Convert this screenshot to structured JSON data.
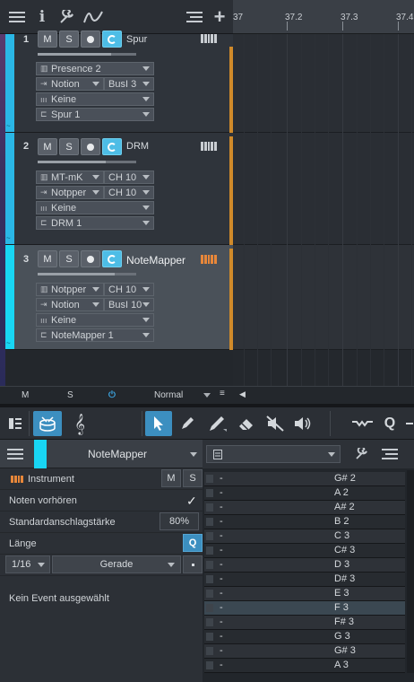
{
  "toolbar": {
    "icons": [
      "menu-icon",
      "info-icon",
      "wrench-icon",
      "automation-curve-icon",
      "list-icon",
      "plus-icon"
    ]
  },
  "ruler": {
    "marks": [
      "37",
      "37.2",
      "37.3",
      "37.4"
    ]
  },
  "tracks": [
    {
      "number": "1",
      "name": "Spur",
      "mute": "M",
      "solo": "S",
      "rows": [
        {
          "icon": "keyboard-icon",
          "a": "Presence 2",
          "b": ""
        },
        {
          "icon": "input-icon",
          "a": "Notion",
          "b": "BusI 3"
        },
        {
          "icon": "bars-icon",
          "a": "Keine",
          "b": ""
        },
        {
          "icon": "output-icon",
          "a": "Spur 1",
          "b": ""
        }
      ]
    },
    {
      "number": "2",
      "name": "DRM",
      "mute": "M",
      "solo": "S",
      "rows": [
        {
          "icon": "keyboard-icon",
          "a": "MT-mK",
          "b": "CH 10"
        },
        {
          "icon": "input-icon",
          "a": "Notpper",
          "b": "CH 10"
        },
        {
          "icon": "bars-icon",
          "a": "Keine",
          "b": ""
        },
        {
          "icon": "output-icon",
          "a": "DRM 1",
          "b": ""
        }
      ]
    },
    {
      "number": "3",
      "name": "NoteMapper",
      "mute": "M",
      "solo": "S",
      "rows": [
        {
          "icon": "keyboard-icon",
          "a": "Notpper",
          "b": "CH 10"
        },
        {
          "icon": "input-icon",
          "a": "Notion",
          "b": "BusI 10"
        },
        {
          "icon": "bars-icon",
          "a": "Keine",
          "b": ""
        },
        {
          "icon": "output-icon",
          "a": "NoteMapper 1",
          "b": ""
        }
      ]
    }
  ],
  "status": {
    "m": "M",
    "s": "S",
    "mode": "Normal"
  },
  "editor_toolbar": {
    "tools": [
      "track-list-icon",
      "drum-icon",
      "treble-clef-icon",
      "arrow-tool-icon",
      "pencil-tool-icon",
      "paint-tool-icon",
      "eraser-tool-icon",
      "mute-tool-icon",
      "listen-tool-icon",
      "bend-tool-icon",
      "quantize-icon"
    ]
  },
  "inspector": {
    "track_name": "NoteMapper",
    "instrument_label": "Instrument",
    "mute": "M",
    "solo": "S",
    "preview_label": "Noten vorhören",
    "preview_check": "✓",
    "velocity_label": "Standardanschlagstärke",
    "velocity_value": "80%",
    "length_label": "Länge",
    "length_q": "Q",
    "length_value": "1/16",
    "length_mode": "Gerade",
    "no_event": "Kein Event ausgewählt"
  },
  "note_list": {
    "rows": [
      {
        "left": "-",
        "note": "G# 2"
      },
      {
        "left": "-",
        "note": "A 2"
      },
      {
        "left": "-",
        "note": "A# 2"
      },
      {
        "left": "-",
        "note": "B 2"
      },
      {
        "left": "-",
        "note": "C 3"
      },
      {
        "left": "-",
        "note": "C# 3"
      },
      {
        "left": "-",
        "note": "D 3"
      },
      {
        "left": "-",
        "note": "D# 3"
      },
      {
        "left": "-",
        "note": "E 3"
      },
      {
        "left": "-",
        "note": "F 3"
      },
      {
        "left": "-",
        "note": "F# 3"
      },
      {
        "left": "-",
        "note": "G 3"
      },
      {
        "left": "-",
        "note": "G# 3"
      },
      {
        "left": "-",
        "note": "A 3"
      }
    ],
    "highlighted_index": 9
  },
  "colors": {
    "track_color": "#2ab7e6",
    "selected_track_color": "#18d6f4",
    "monitor_active": "#4dbde6",
    "record_ready_orange": "#d08a2a",
    "tool_active": "#3c8fc0"
  }
}
